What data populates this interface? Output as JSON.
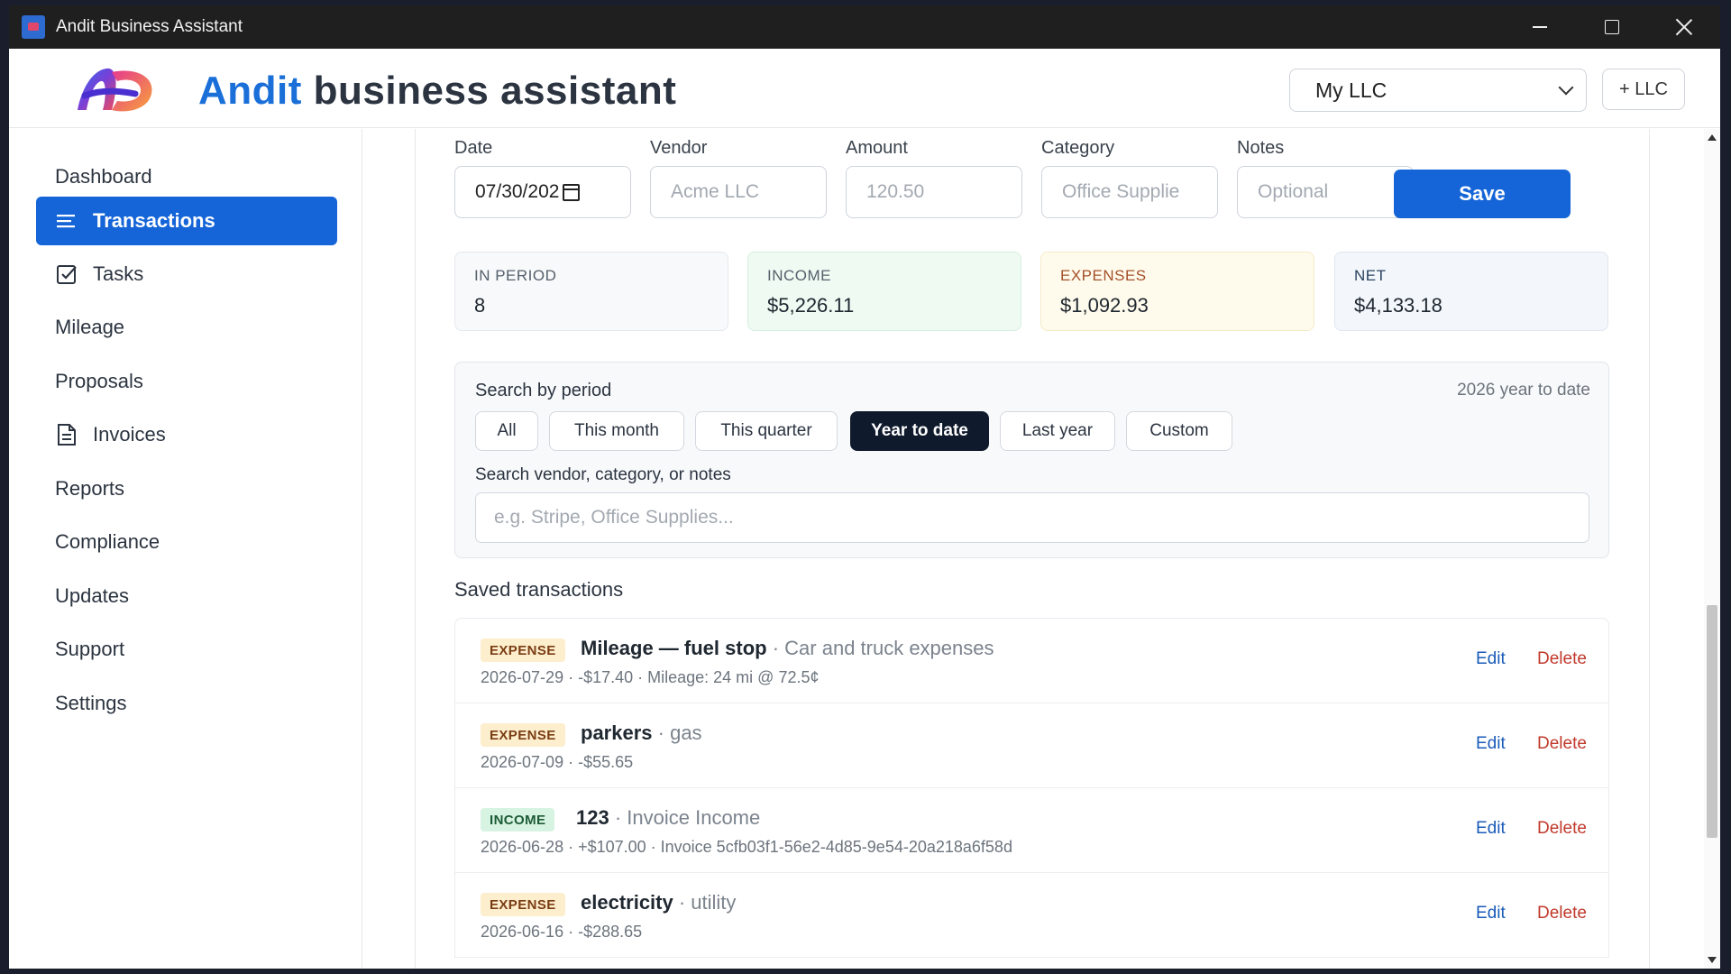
{
  "window": {
    "title": "Andit Business Assistant"
  },
  "header": {
    "brand_accent": "Andit",
    "brand_rest": "business assistant",
    "llc_selected": "My LLC",
    "add_llc_label": "+ LLC"
  },
  "sidebar": {
    "items": [
      {
        "label": "Dashboard"
      },
      {
        "label": "Transactions"
      },
      {
        "label": "Tasks"
      },
      {
        "label": "Mileage"
      },
      {
        "label": "Proposals"
      },
      {
        "label": "Invoices"
      },
      {
        "label": "Reports"
      },
      {
        "label": "Compliance"
      },
      {
        "label": "Updates"
      },
      {
        "label": "Support"
      },
      {
        "label": "Settings"
      }
    ]
  },
  "form": {
    "date_label": "Date",
    "date_value": "07/30/202",
    "vendor_label": "Vendor",
    "vendor_placeholder": "Acme LLC",
    "amount_label": "Amount",
    "amount_placeholder": "120.50",
    "category_label": "Category",
    "category_placeholder": "Office Supplie",
    "notes_label": "Notes",
    "notes_placeholder": "Optional",
    "save_label": "Save"
  },
  "stats": {
    "period_label": "IN PERIOD",
    "period_value": "8",
    "income_label": "INCOME",
    "income_value": "$5,226.11",
    "expenses_label": "EXPENSES",
    "expenses_value": "$1,092.93",
    "net_label": "NET",
    "net_value": "$4,133.18"
  },
  "search": {
    "title": "Search by period",
    "range_text": "2026 year to date",
    "periods": [
      "All",
      "This month",
      "This quarter",
      "Year to date",
      "Last year",
      "Custom"
    ],
    "active_period": "Year to date",
    "text_label": "Search vendor, category, or notes",
    "text_placeholder": "e.g. Stripe, Office Supplies..."
  },
  "transactions": {
    "title": "Saved transactions",
    "edit_label": "Edit",
    "delete_label": "Delete",
    "items": [
      {
        "type": "EXPENSE",
        "vendor": "Mileage — fuel stop",
        "category": "· Car and truck expenses",
        "detail": "2026-07-29 · -$17.40 · Mileage: 24 mi @ 72.5¢"
      },
      {
        "type": "EXPENSE",
        "vendor": "parkers",
        "category": "· gas",
        "detail": "2026-07-09 · -$55.65"
      },
      {
        "type": "INCOME",
        "vendor": "123",
        "category": "· Invoice Income",
        "detail": "2026-06-28 · +$107.00 · Invoice 5cfb03f1-56e2-4d85-9e54-20a218a6f58d"
      },
      {
        "type": "EXPENSE",
        "vendor": "electricity",
        "category": "· utility",
        "detail": "2026-06-16 · -$288.65"
      }
    ]
  },
  "colors": {
    "accent": "#1565d8",
    "active_pill": "#0f1b2d",
    "expense_badge": "#fdeecd",
    "income_badge": "#d7f3e2",
    "delete": "#c0392b"
  }
}
